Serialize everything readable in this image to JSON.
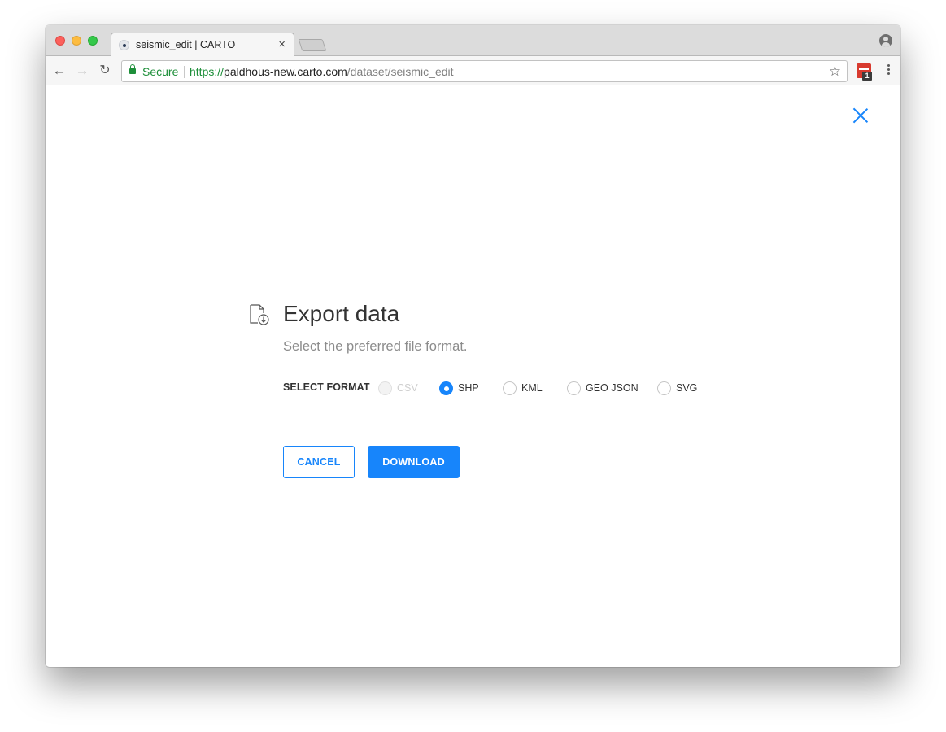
{
  "browser": {
    "tab": {
      "title": "seismic_edit | CARTO",
      "close_glyph": "×"
    },
    "toolbar": {
      "back_glyph": "←",
      "forward_glyph": "→",
      "reload_glyph": "↻",
      "secure_label": "Secure",
      "url_scheme": "https://",
      "url_host": "paldhous-new.carto.com",
      "url_path": "/dataset/seismic_edit",
      "star_glyph": "☆",
      "extension_badge": "1"
    }
  },
  "dialog": {
    "title": "Export data",
    "subtitle": "Select the preferred file format.",
    "format_label": "SELECT FORMAT",
    "formats": [
      {
        "label": "CSV",
        "checked": false,
        "disabled": true
      },
      {
        "label": "SHP",
        "checked": true,
        "disabled": false
      },
      {
        "label": "KML",
        "checked": false,
        "disabled": false
      },
      {
        "label": "GEO JSON",
        "checked": false,
        "disabled": false
      },
      {
        "label": "SVG",
        "checked": false,
        "disabled": false
      }
    ],
    "cancel_label": "CANCEL",
    "download_label": "DOWNLOAD"
  },
  "colors": {
    "accent": "#1785fb",
    "secure_green": "#1e8f3a"
  }
}
